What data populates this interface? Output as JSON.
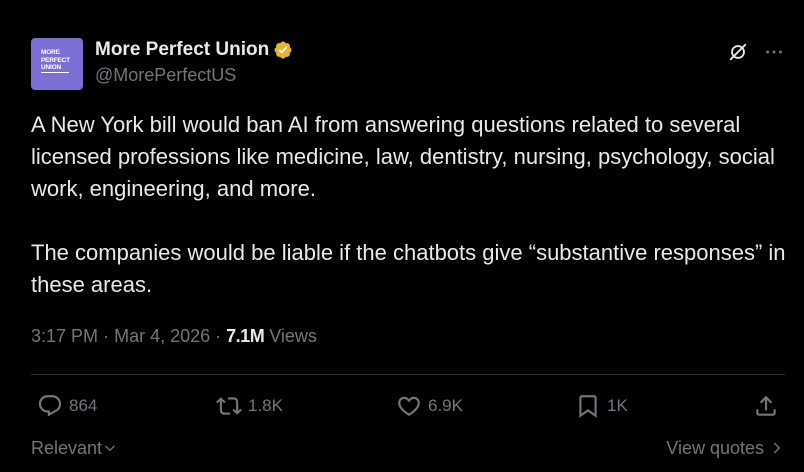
{
  "author": {
    "display_name": "More Perfect Union",
    "handle": "@MorePerfectUS",
    "verified_badge": "verified-badge-icon",
    "avatar_logo_lines": [
      "MORE",
      "PERFECT",
      "UNION"
    ],
    "avatar_color": "#7b6fd6",
    "verified_color": "#e8b62e"
  },
  "header_actions": {
    "grok_icon": "grok-icon",
    "more_icon": "more-icon"
  },
  "tweet": {
    "paragraph_1": "A New York bill would ban AI from answering questions related to several licensed professions like medicine, law, dentistry, nursing, psychology, social work, engineering, and more.",
    "paragraph_2": "The companies would be liable if the chatbots give “substantive responses” in these areas."
  },
  "meta": {
    "time": "3:17 PM",
    "separator": "·",
    "date": "Mar 4, 2026",
    "views_count": "7.1M",
    "views_label": "Views"
  },
  "actions": {
    "replies": "864",
    "reposts": "1.8K",
    "likes": "6.9K",
    "bookmarks": "1K"
  },
  "footer": {
    "sort_label": "Relevant",
    "view_quotes_label": "View quotes"
  },
  "colors": {
    "background": "#000000",
    "text_primary": "#e7e9ea",
    "text_secondary": "#71767b",
    "divider": "#2f3336"
  }
}
